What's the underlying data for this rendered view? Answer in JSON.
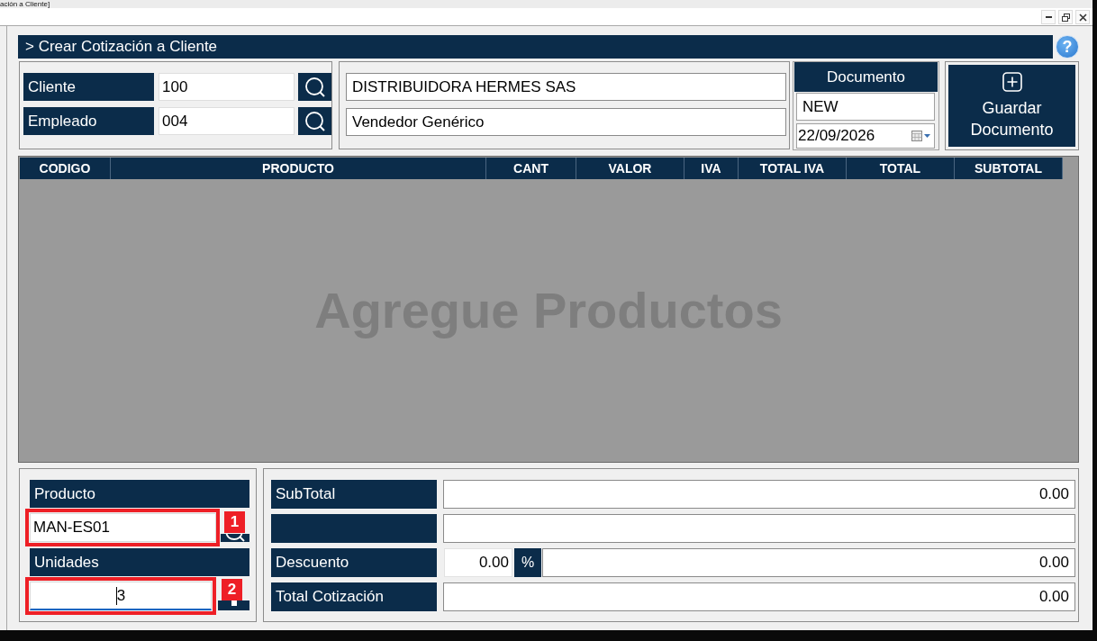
{
  "window": {
    "title": "ación a Cliente]"
  },
  "header": {
    "title": "> Crear Cotización a Cliente",
    "help": "?"
  },
  "party_fields": [
    {
      "label": "Cliente",
      "code": "100",
      "name": "DISTRIBUIDORA HERMES SAS"
    },
    {
      "label": "Empleado",
      "code": "004",
      "name": "Vendedor Genérico"
    }
  ],
  "document": {
    "title": "Documento",
    "number": "NEW",
    "date": "22/09/2026"
  },
  "save_button": {
    "label": "Guardar Documento"
  },
  "table": {
    "columns": [
      "CODIGO",
      "PRODUCTO",
      "CANT",
      "VALOR",
      "IVA",
      "TOTAL IVA",
      "TOTAL",
      "SUBTOTAL"
    ],
    "empty_message": "Agregue Productos"
  },
  "product_entry": {
    "product": {
      "label": "Producto",
      "value": "MAN-ES01",
      "callout": "1"
    },
    "units": {
      "label": "Unidades",
      "value": "3",
      "focused": true,
      "callout": "2"
    }
  },
  "totals": [
    {
      "kind": "amount",
      "label": "SubTotal",
      "value": "0.00"
    },
    {
      "kind": "blank"
    },
    {
      "kind": "discount",
      "label": "Descuento",
      "percent": "0.00",
      "unit": "%",
      "value": "0.00"
    },
    {
      "kind": "amount",
      "label": "Total Cotización",
      "value": "0.00"
    }
  ]
}
